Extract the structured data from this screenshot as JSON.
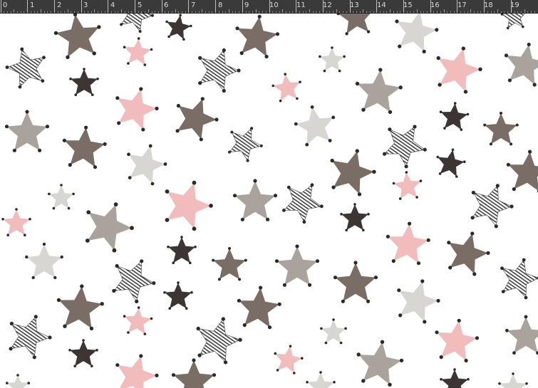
{
  "ruler": {
    "labels": [
      "0",
      "1",
      "2",
      "3",
      "4",
      "5",
      "6",
      "7",
      "8",
      "9",
      "10",
      "11",
      "12",
      "13",
      "14",
      "15",
      "16",
      "17",
      "18",
      "19"
    ]
  },
  "canvas": {
    "pattern": "scattered-five-point-stars",
    "colors": {
      "ruler_background": "#3a3a3a",
      "ruler_text": "#d9d9d9",
      "canvas_background": "#ffffff",
      "star_brown": "#7a6d66",
      "star_dark": "#3d3533",
      "star_pink": "#f2bcbc",
      "star_taupe": "#aaa29c",
      "star_light": "#d8d6d2",
      "star_zebra_stroke": "#3f3f3f",
      "dot": "#2a2a2a"
    }
  }
}
